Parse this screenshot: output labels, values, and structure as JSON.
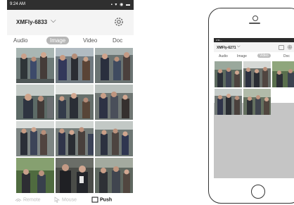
{
  "left_app": {
    "status": {
      "time": "9:24 AM",
      "icons": "▪ ▾ ◉ ▬"
    },
    "header": {
      "device_name": "XMFly-6833",
      "chevron": "chevron-down-icon",
      "settings_icon": "gear-icon"
    },
    "tabs": [
      {
        "label": "Audio",
        "selected": false
      },
      {
        "label": "Image",
        "selected": true
      },
      {
        "label": "Video",
        "selected": false
      },
      {
        "label": "Doc",
        "selected": false
      }
    ],
    "bottom_bar": [
      {
        "label": "Remote",
        "icon": "remote-icon",
        "selected": false
      },
      {
        "label": "Mouse",
        "icon": "mouse-icon",
        "selected": false
      },
      {
        "label": "Push",
        "icon": "push-icon",
        "selected": true
      }
    ]
  },
  "right_app": {
    "status": {
      "time": "2:31 ∙∙∙",
      "icons": "▪ ▾ ▬"
    },
    "header": {
      "device_name": "XMFly-6271",
      "chevron": "chevron-down-icon"
    },
    "tabs": [
      {
        "label": "Audio",
        "selected": false
      },
      {
        "label": "Image",
        "selected": false
      },
      {
        "label": "Video",
        "selected": true
      },
      {
        "label": "Doc",
        "selected": false
      }
    ]
  },
  "colors": {
    "status_bar": "#2f2f2f",
    "header_bg": "#f4f4f4",
    "tab_selected_bg": "#b7b7b7",
    "empty_area": "#c5c5c5"
  }
}
